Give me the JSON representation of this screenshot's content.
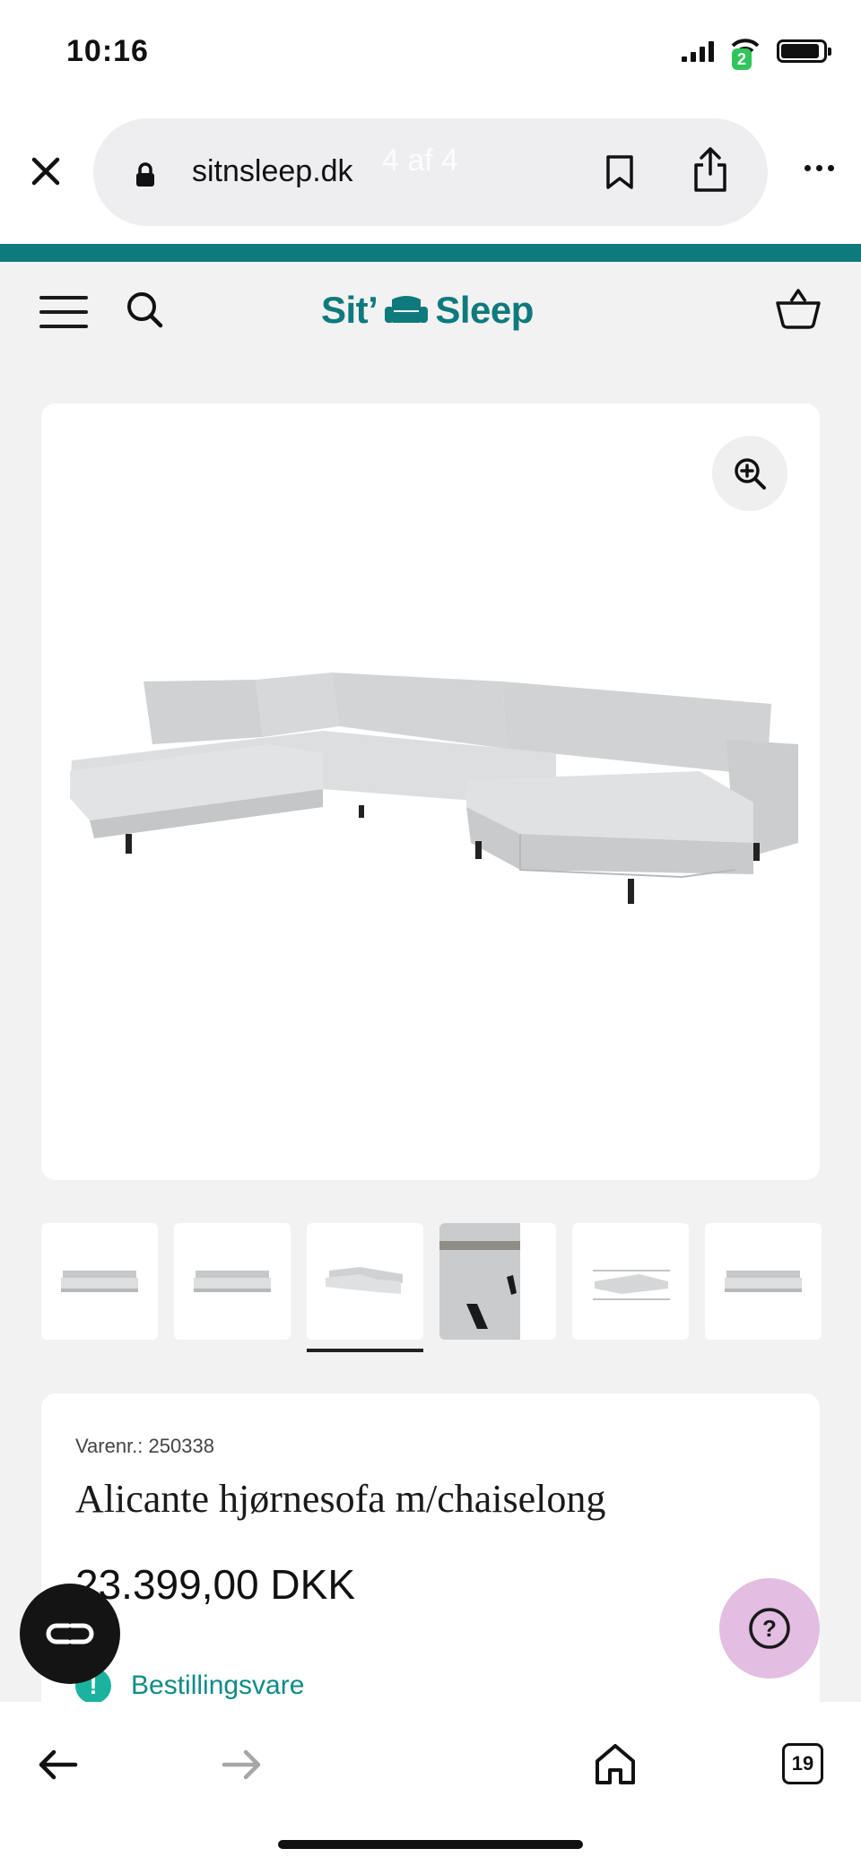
{
  "status_bar": {
    "time": "10:16",
    "notification_badge": "2"
  },
  "browser": {
    "url": "sitnsleep.dk",
    "page_counter": "4 af 4",
    "tabs_count": "19"
  },
  "site": {
    "logo_left": "Sit’",
    "logo_right": "Sleep",
    "brand_color": "#0e7a7d"
  },
  "gallery": {
    "thumbnail_count": 6,
    "selected_index": 2
  },
  "product": {
    "sku": "Varenr.: 250338",
    "title": "Alicante hjørnesofa m/chaiselong",
    "price": "23.399,00 DKK",
    "availability": "Bestillingsvare",
    "availability_icon": "!"
  },
  "help_fab": {
    "label": "?"
  },
  "icons": {
    "close": "close-icon",
    "lock": "lock-icon",
    "bookmark": "bookmark-icon",
    "share": "share-icon",
    "more": "more-icon",
    "menu": "hamburger-icon",
    "search": "search-icon",
    "basket": "basket-icon",
    "zoom": "zoom-in-icon",
    "chat": "chat-icon",
    "help": "help-icon",
    "back": "back-arrow-icon",
    "forward": "forward-arrow-icon",
    "home": "home-icon",
    "tabs": "tabs-icon"
  }
}
